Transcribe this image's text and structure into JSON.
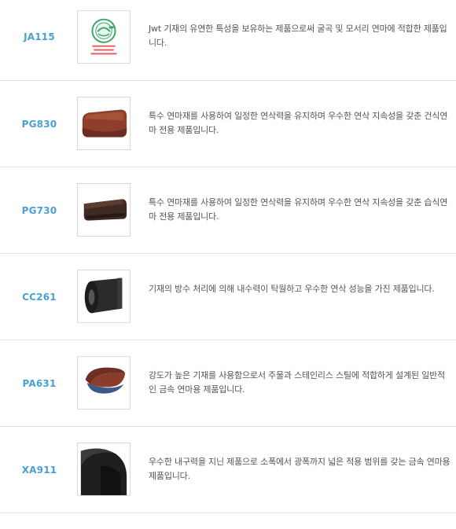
{
  "products": [
    {
      "code": "JA115",
      "image": "certification-logo",
      "description": "Jwt 기재의 유연한 특성을 보유하는 제품으로써 굴곡 및 모서리 연마에 적합한 제품입니다."
    },
    {
      "code": "PG830",
      "image": "sanding-belt-brown-image",
      "description": "특수 연마재를 사용하여 일정한 연삭력을 유지하며 우수한 연삭 지속성을 갖춘 건식연마 전용 제품입니다."
    },
    {
      "code": "PG730",
      "image": "sanding-belt-dark-brown-image",
      "description": "특수 연마재를 사용하여 일정한 연삭력을 유지하며 우수한 연삭 지속성을 갖춘 습식연마 전용 제품입니다."
    },
    {
      "code": "CC261",
      "image": "abrasive-roll-black-image",
      "description": "기재의 방수 처리에 의해 내수력이 탁월하고 우수한 연삭 성능을 가진 제품입니다."
    },
    {
      "code": "PA631",
      "image": "sanding-belt-loop-image",
      "description": "강도가 높은 기재를 사용함으로서 주물과 스테인리스 스틸에 적합하게 설계된 일반적인 금속 연마용 제품입니다."
    },
    {
      "code": "XA911",
      "image": "wide-belt-black-image",
      "description": "우수한 내구력을 지닌 제품으로 소폭에서 광폭까지 넓은 적용 범위를 갖는 금속 연마용 제품입니다."
    }
  ],
  "logo_text": [
    "품질인증",
    "한국산업기술진흥협회",
    "품목인증 제품"
  ]
}
